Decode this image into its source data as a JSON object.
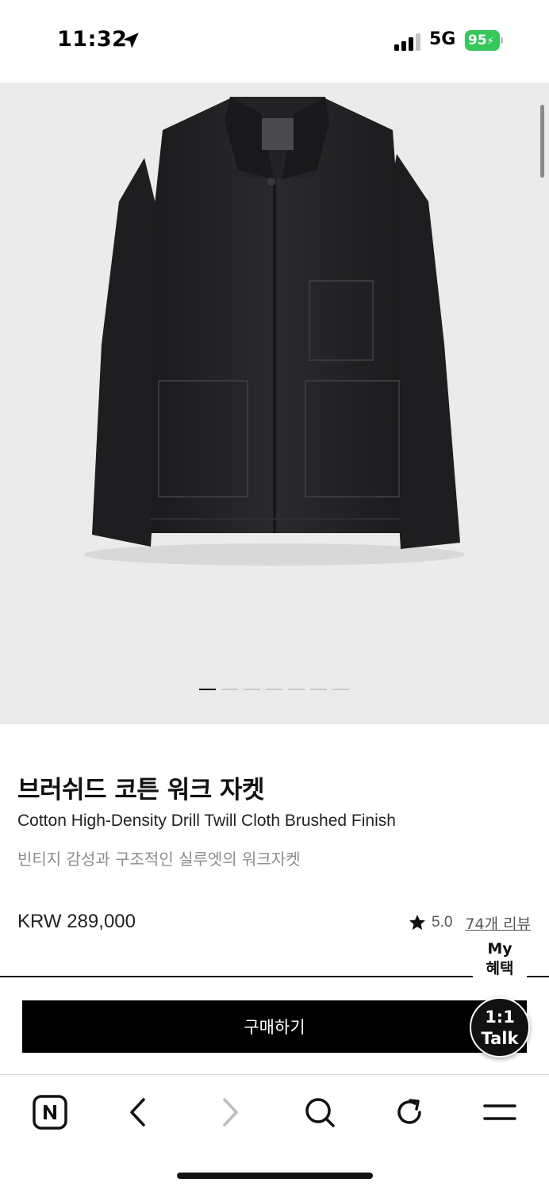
{
  "status_bar": {
    "time": "11:32",
    "network": "5G",
    "battery": "95"
  },
  "hero": {
    "slide_count": 7,
    "active_slide": 1
  },
  "product": {
    "title": "브러쉬드 코튼 워크 자켓",
    "subtitle": "Cotton High-Density Drill Twill Cloth Brushed Finish",
    "description": "빈티지 감성과 구조적인 실루엣의 워크자켓",
    "price": "KRW 289,000",
    "rating": "5.0",
    "reviews": "74개 리뷰"
  },
  "floating": {
    "my_benefit_line1": "My",
    "my_benefit_line2": "혜택",
    "talk_line1": "1:1",
    "talk_line2": "Talk"
  },
  "cta": {
    "buy_label": "구매하기"
  },
  "toolbar": {
    "items": [
      "naver-home-icon",
      "back-icon",
      "forward-icon",
      "search-icon",
      "refresh-icon",
      "menu-icon"
    ]
  },
  "colors": {
    "battery": "#35c759",
    "hero_bg": "#ebebeb",
    "cta_bg": "#000000"
  }
}
